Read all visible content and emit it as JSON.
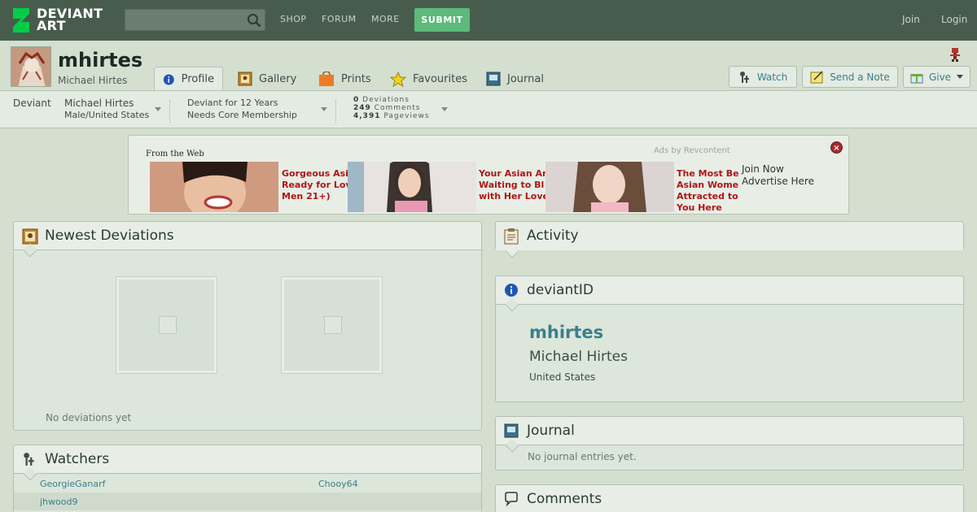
{
  "topbar": {
    "logo_line1": "DEVIANT",
    "logo_line2": "ART",
    "search_placeholder": "",
    "nav": [
      "SHOP",
      "FORUM",
      "MORE"
    ],
    "submit_label": "SUBMIT",
    "join_label": "Join",
    "login_label": "Login"
  },
  "profile": {
    "username": "mhirtes",
    "realname": "Michael Hirtes",
    "tabs": [
      {
        "label": "Profile",
        "icon": "info-icon"
      },
      {
        "label": "Gallery",
        "icon": "gallery-icon"
      },
      {
        "label": "Prints",
        "icon": "prints-icon"
      },
      {
        "label": "Favourites",
        "icon": "star-icon"
      },
      {
        "label": "Journal",
        "icon": "journal-icon"
      }
    ],
    "buttons": {
      "watch": "Watch",
      "note": "Send a Note",
      "give": "Give"
    }
  },
  "strip": {
    "deviant_label": "Deviant",
    "name": "Michael Hirtes",
    "location": "Male/United States",
    "tenure": "Deviant for 12 Years",
    "membership": "Needs Core Membership",
    "deviations_num": "0",
    "deviations_label": "Deviations",
    "comments_num": "249",
    "comments_label": "Comments",
    "pageviews_num": "4,391",
    "pageviews_label": "Pageviews"
  },
  "ad": {
    "from": "From the Web",
    "by": "Ads by Revcontent",
    "captions": [
      [
        "Gorgeous Asi",
        "Ready for Lov",
        "Men 21+)"
      ],
      [
        "Your Asian An",
        "Waiting to Bl",
        "with Her Love"
      ],
      [
        "The Most Be",
        "Asian Wome",
        "Attracted to",
        "You Here"
      ]
    ],
    "join_now": "Join Now",
    "advertise": "Advertise Here",
    "close": "×"
  },
  "newest": {
    "title": "Newest Deviations",
    "empty": "No deviations yet"
  },
  "watchers": {
    "title": "Watchers",
    "names": [
      "GeorgieGanarf",
      "Chooy64",
      "jhwood9"
    ]
  },
  "activity": {
    "title": "Activity"
  },
  "deviantid": {
    "title": "deviantID",
    "username": "mhirtes",
    "realname": "Michael Hirtes",
    "country": "United States"
  },
  "journal": {
    "title": "Journal",
    "empty": "No journal entries yet."
  },
  "comments": {
    "title": "Comments"
  },
  "colors": {
    "topbar": "#475c4d",
    "submit": "#5dba7a",
    "link": "#3b7f8a",
    "page": "#d4dfd0"
  }
}
